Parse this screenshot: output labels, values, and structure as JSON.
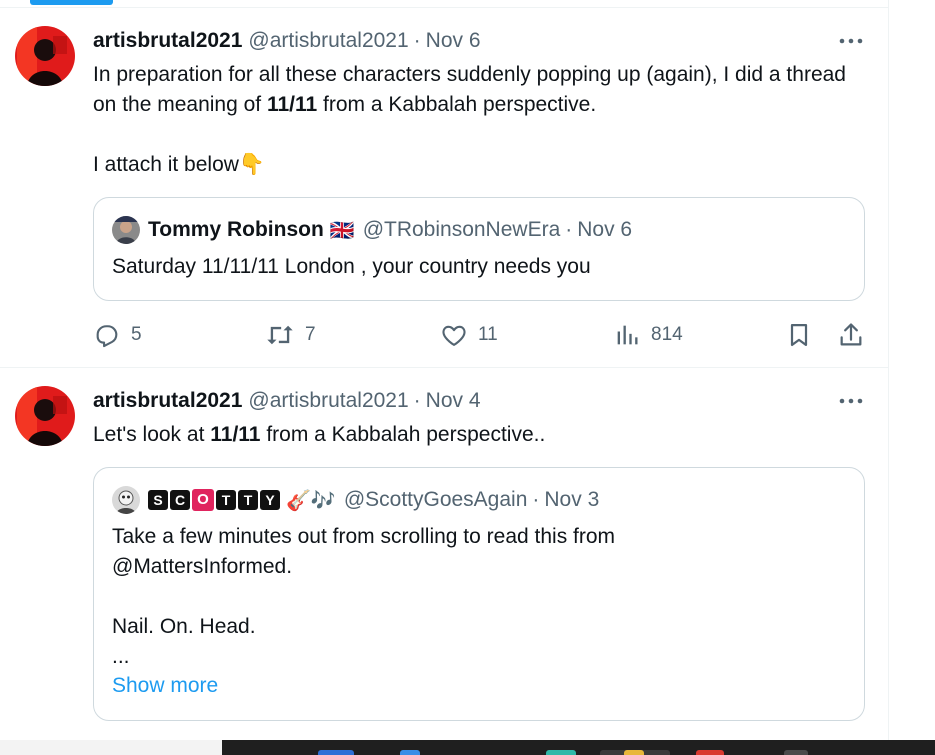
{
  "posts": [
    {
      "name": "artisbrutal2021",
      "handle": "@artisbrutal2021",
      "sep": "·",
      "date": "Nov 6",
      "text_before": "In preparation for all these characters suddenly popping up (again), I did a thread on the meaning of ",
      "text_bold": "11/11",
      "text_after": " from a Kabbalah perspective.\n\nI attach it below",
      "emoji": "👇",
      "quote": {
        "name": "Tommy Robinson",
        "flag": "🇬🇧",
        "handle": "@TRobinsonNewEra",
        "sep": "·",
        "date": "Nov 6",
        "text": "Saturday 11/11/11 London , your country needs you"
      },
      "actions": {
        "replies": "5",
        "reposts": "7",
        "likes": "11",
        "views": "814"
      }
    },
    {
      "name": "artisbrutal2021",
      "handle": "@artisbrutal2021",
      "sep": "·",
      "date": "Nov 4",
      "text_before": "Let's look at ",
      "text_bold": "11/11",
      "text_after": " from a Kabbalah perspective..",
      "quote": {
        "name_letters": [
          "S",
          "C",
          "O",
          "T",
          "T",
          "Y"
        ],
        "emoji": "🎸🎶",
        "handle": "@ScottyGoesAgain",
        "sep": "·",
        "date": "Nov 3",
        "text": "Take a few minutes out from scrolling to read this from\n@MattersInformed.\n\nNail. On. Head.\n...",
        "show_more": "Show more"
      }
    }
  ],
  "icons": {
    "more": "more-horizontal-icon",
    "reply": "reply-icon",
    "repost": "repost-icon",
    "like": "heart-icon",
    "views": "views-icon",
    "bookmark": "bookmark-icon",
    "share": "share-icon"
  },
  "colors": {
    "accent": "#1d9bf0",
    "muted": "#536471",
    "text": "#0f1419",
    "border": "#cfd9de"
  }
}
